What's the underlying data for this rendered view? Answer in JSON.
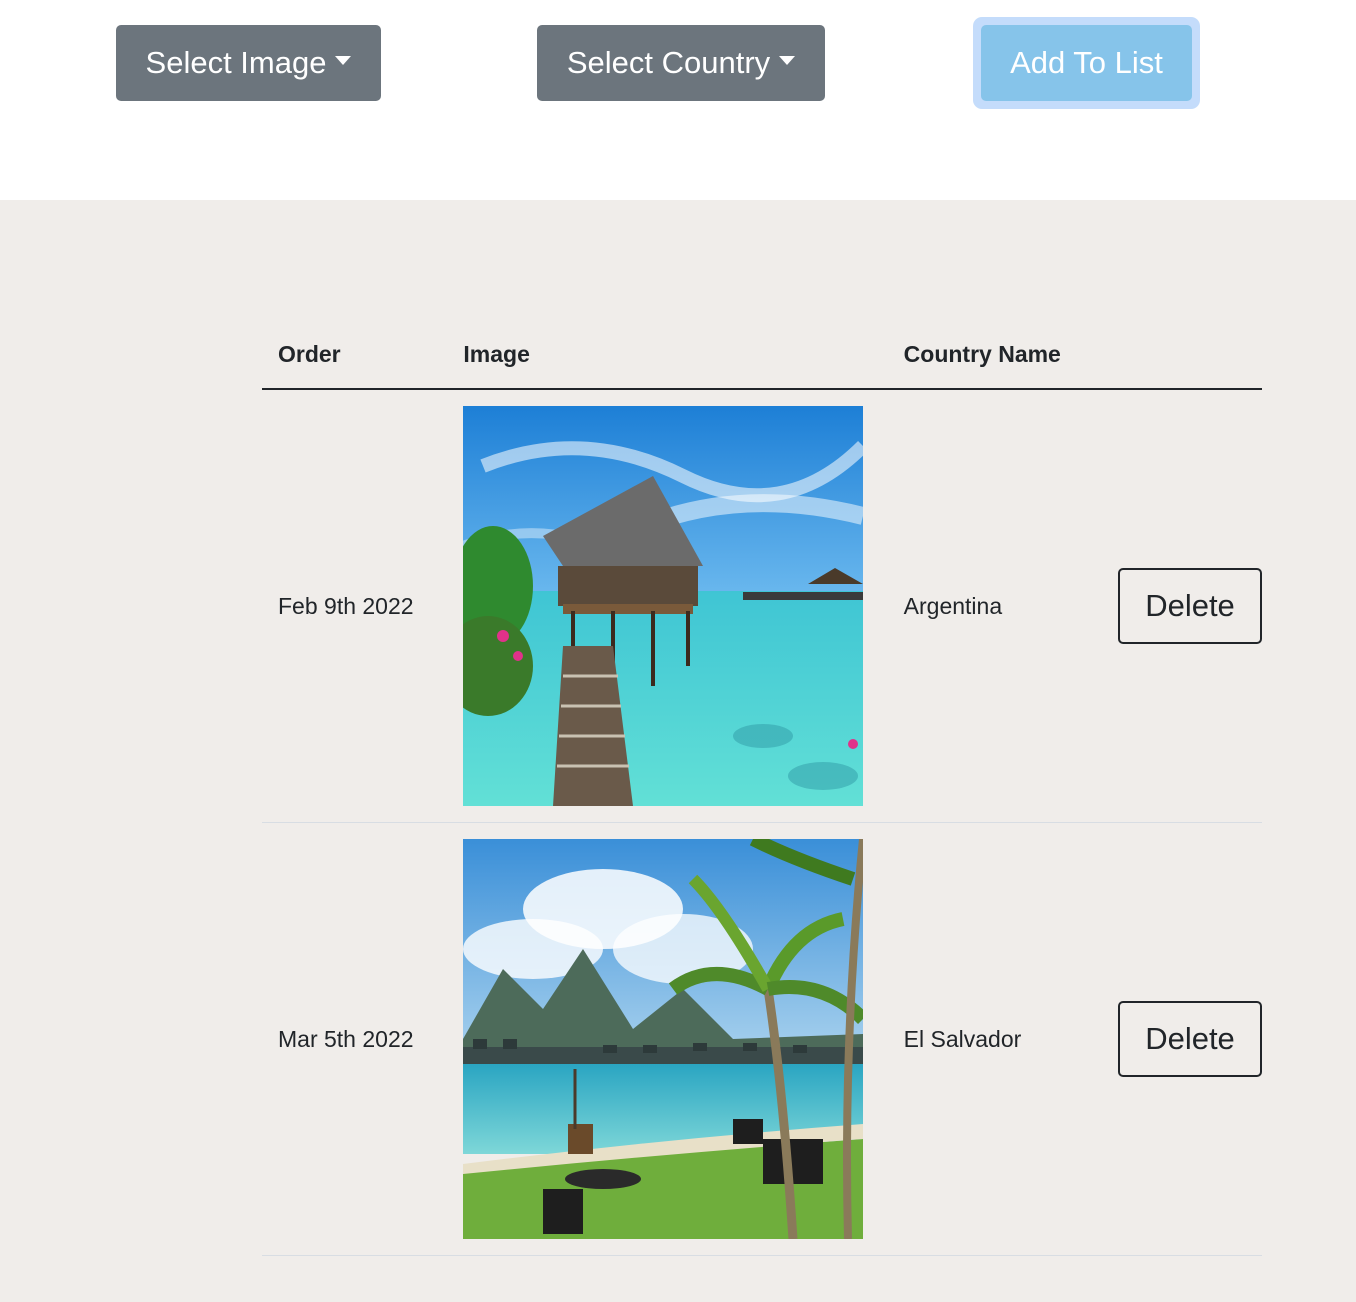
{
  "toolbar": {
    "select_image_label": "Select Image",
    "select_country_label": "Select Country",
    "add_label": "Add To List"
  },
  "table": {
    "headers": {
      "order": "Order",
      "image": "Image",
      "country": "Country Name"
    },
    "rows": [
      {
        "order": "Feb 9th 2022",
        "country": "Argentina",
        "delete_label": "Delete",
        "image": "overwater-pavilion-photo"
      },
      {
        "order": "Mar 5th 2022",
        "country": "El Salvador",
        "delete_label": "Delete",
        "image": "palm-beach-bungalows-photo"
      }
    ]
  },
  "colors": {
    "dropdown": "#6c757d",
    "add_button": "#86c4ea",
    "page_background": "#f0edea"
  }
}
